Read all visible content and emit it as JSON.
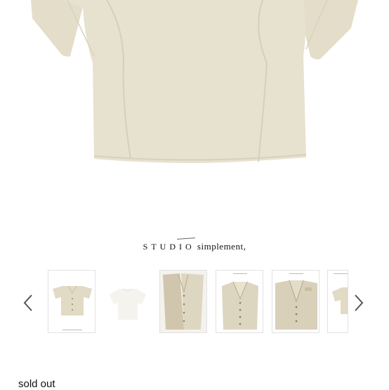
{
  "brand": {
    "studio": "STUDIO",
    "rest": "simplement,"
  },
  "product": {
    "status": "sold out"
  },
  "colors": {
    "garment": "#e7e1cf",
    "garment_shadow": "#dcd5c0",
    "text": "#111111"
  },
  "icons": {
    "prev": "chevron-left-icon",
    "next": "chevron-right-icon"
  }
}
